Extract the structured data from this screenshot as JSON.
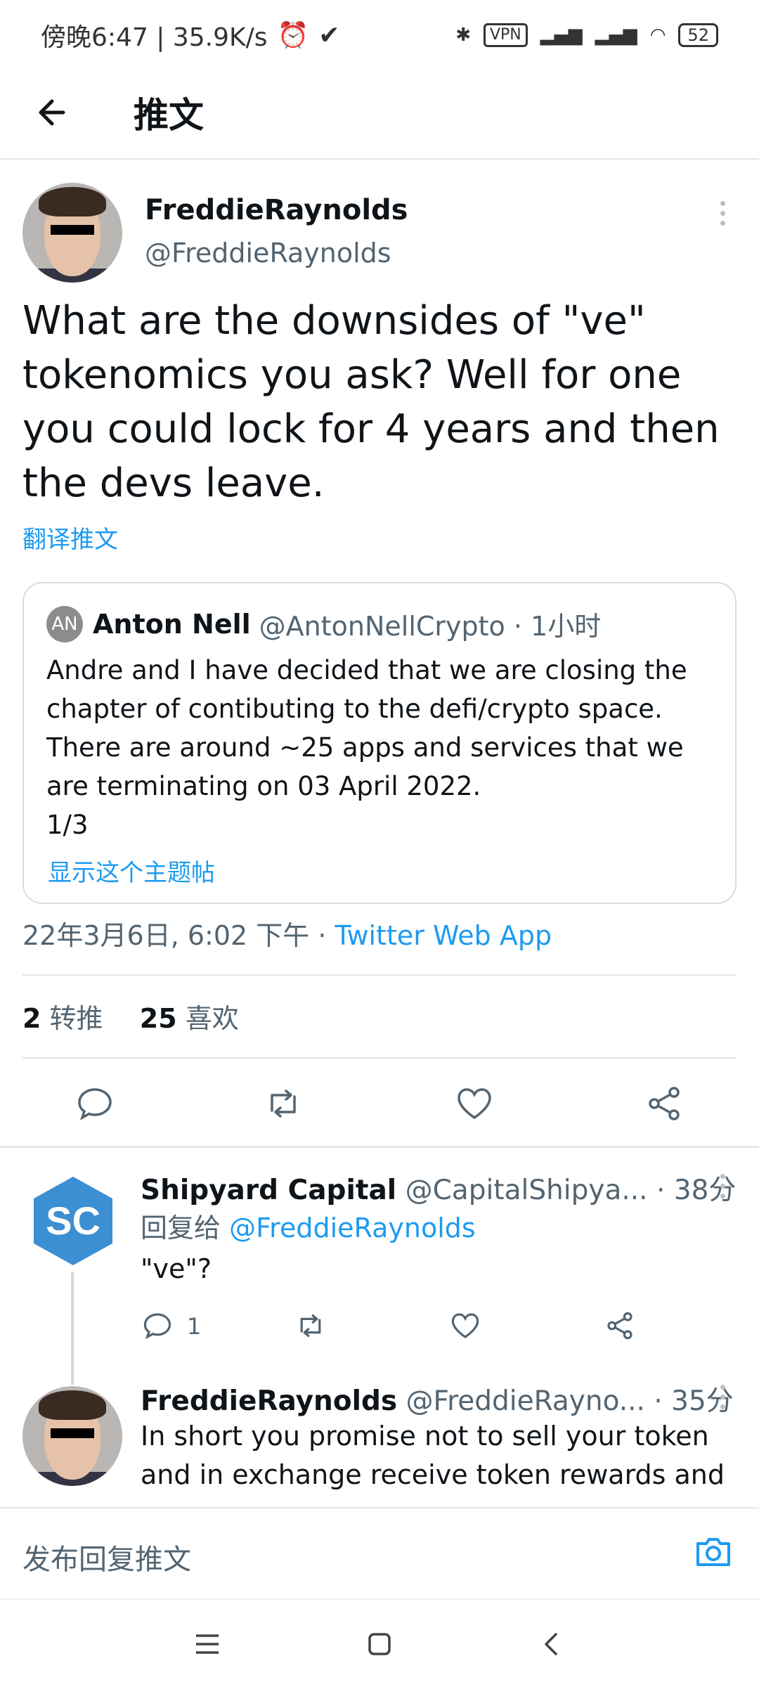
{
  "status_bar": {
    "time_speed": "傍晚6:47 | 35.9K/s",
    "vpn": "VPN",
    "battery": "52"
  },
  "header": {
    "title": "推文"
  },
  "tweet": {
    "display_name": "FreddieRaynolds",
    "handle": "@FreddieRaynolds",
    "text": "What are the downsides of \"ve\" tokenomics you ask?  Well for one you could lock for 4 years and then the devs leave.",
    "translate": "翻译推文",
    "quote": {
      "avatar_initials": "AN",
      "name": "Anton Nell",
      "handle_time": "@AntonNellCrypto · 1小时",
      "body": "Andre and I have decided that we are closing the chapter of contibuting to the defi/crypto space. There are around ~25 apps and services that we are terminating on 03 April 2022.",
      "page": "1/3",
      "show_thread": "显示这个主题帖"
    },
    "timestamp": "22年3月6日, 6:02 下午 · ",
    "source": "Twitter Web App",
    "retweets_count": "2",
    "retweets_label": "转推",
    "likes_count": "25",
    "likes_label": "喜欢"
  },
  "replies": [
    {
      "avatar_initials": "SC",
      "name": "Shipyard Capital",
      "handle_time": "@CapitalShipya... · 38分",
      "reply_to_label": "回复给 ",
      "reply_to_handle": "@FreddieRaynolds",
      "text": "\"ve\"?",
      "reply_count": "1"
    },
    {
      "name": "FreddieRaynolds",
      "handle_time": "@FreddieRayno... · 35分",
      "text": "In short you promise not to sell your token and in exchange receive token rewards and"
    }
  ],
  "composer": {
    "placeholder": "发布回复推文"
  },
  "colors": {
    "accent": "#1d9bf0",
    "sc_avatar": "#3c8fd3"
  }
}
